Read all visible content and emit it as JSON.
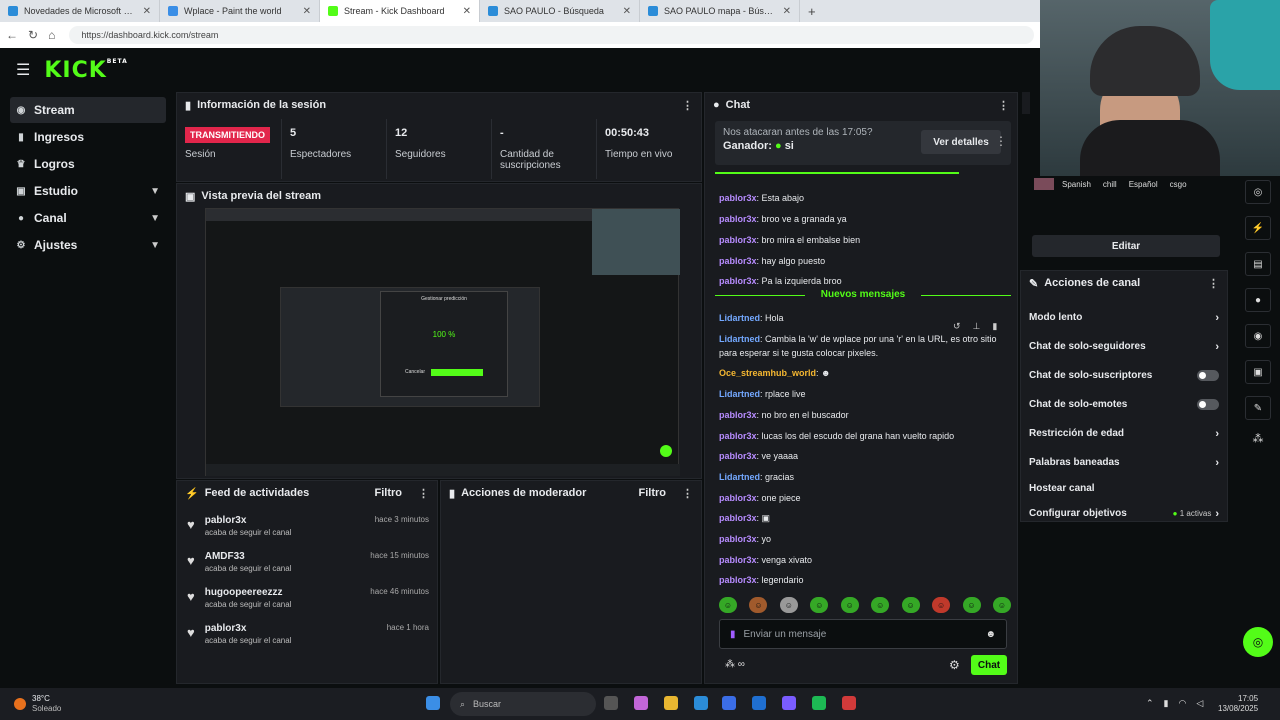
{
  "browser": {
    "tabs": [
      {
        "label": "Novedades de Microsoft Edge",
        "color": "#2b8cd8"
      },
      {
        "label": "Wplace - Paint the world",
        "color": "#3a8ee6"
      },
      {
        "label": "Stream - Kick Dashboard",
        "color": "#53fc18"
      },
      {
        "label": "SAO PAULO - Búsqueda",
        "color": "#2b8cd8"
      },
      {
        "label": "SAO PAULO mapa - Búsqueda Im",
        "color": "#2b8cd8"
      }
    ],
    "url": "https://dashboard.kick.com/stream"
  },
  "logo": "KICK",
  "logo_beta": "BETA",
  "sidebar": {
    "items": [
      {
        "label": "Stream",
        "icon": "stream-icon",
        "active": true
      },
      {
        "label": "Ingresos",
        "icon": "revenue-icon"
      },
      {
        "label": "Logros",
        "icon": "trophy-icon"
      },
      {
        "label": "Estudio",
        "icon": "studio-icon",
        "chev": true
      },
      {
        "label": "Canal",
        "icon": "user-icon",
        "chev": true
      },
      {
        "label": "Ajustes",
        "icon": "gear-icon",
        "chev": true
      }
    ]
  },
  "session": {
    "title": "Información de la sesión",
    "live": "TRANSMITIENDO",
    "live_label": "Sesión",
    "stats": [
      {
        "value": "5",
        "label": "Espectadores"
      },
      {
        "value": "12",
        "label": "Seguidores"
      },
      {
        "value": "-",
        "label": "Cantidad de suscripciones"
      },
      {
        "value": "00:50:43",
        "label": "Tiempo en vivo"
      }
    ]
  },
  "preview": {
    "title": "Vista previa del stream",
    "inner_title": "Gestionar predicción",
    "inner_pct": "100 %",
    "inner_cancel": "Cancelar"
  },
  "feed": {
    "title": "Feed de actividades",
    "filter": "Filtro",
    "items": [
      {
        "name": "pablor3x",
        "sub": "acaba de seguir el canal",
        "time": "hace 3 minutos"
      },
      {
        "name": "AMDF33",
        "sub": "acaba de seguir el canal",
        "time": "hace 15 minutos"
      },
      {
        "name": "hugoopeereezzz",
        "sub": "acaba de seguir el canal",
        "time": "hace 46 minutos"
      },
      {
        "name": "pablor3x",
        "sub": "acaba de seguir el canal",
        "time": "hace 1 hora"
      }
    ]
  },
  "mod": {
    "title": "Acciones de moderador",
    "filter": "Filtro"
  },
  "chat": {
    "title": "Chat",
    "prediction": {
      "question": "Nos atacaran antes de las 17:05?",
      "winner_label": "Ganador:",
      "winner": "si",
      "details": "Ver detalles"
    },
    "old": [
      {
        "user": "pablor3x",
        "text": "Esta abajo"
      },
      {
        "user": "pablor3x",
        "text": "broo ve a granada ya"
      },
      {
        "user": "pablor3x",
        "text": "bro mira el embalse bien"
      },
      {
        "user": "pablor3x",
        "text": "hay algo puesto"
      },
      {
        "user": "pablor3x",
        "text": "Pa la izquierda broo"
      }
    ],
    "new_label": "Nuevos mensajes",
    "new": [
      {
        "user": "Lidartned",
        "cls": "l",
        "text": "Hola"
      },
      {
        "user": "Lidartned",
        "cls": "l",
        "text": "Cambia la 'w' de wplace por una 'r' en la URL, es otro sitio para esperar si te gusta colocar pixeles."
      },
      {
        "user": "Oce_streamhub_world",
        "cls": "o",
        "text": "☻"
      },
      {
        "user": "Lidartned",
        "cls": "l",
        "text": "rplace live"
      },
      {
        "user": "pablor3x",
        "cls": "p",
        "text": "no bro en el buscador"
      },
      {
        "user": "pablor3x",
        "cls": "p",
        "text": "lucas los del escudo del grana han vuelto rapido"
      },
      {
        "user": "pablor3x",
        "cls": "p",
        "text": "ve yaaaa"
      },
      {
        "user": "Lidartned",
        "cls": "l",
        "text": "gracias"
      },
      {
        "user": "pablor3x",
        "cls": "p",
        "text": "one piece"
      },
      {
        "user": "pablor3x",
        "cls": "p",
        "text": "▣"
      },
      {
        "user": "pablor3x",
        "cls": "p",
        "text": "yo"
      },
      {
        "user": "pablor3x",
        "cls": "p",
        "text": "venga xivato"
      },
      {
        "user": "pablor3x",
        "cls": "p",
        "text": "legendario"
      }
    ],
    "placeholder": "Enviar un mensaje",
    "send": "Chat",
    "points": "∞"
  },
  "right": {
    "tags": [
      "Spanish",
      "chill",
      "Español",
      "csgo"
    ],
    "edit": "Editar",
    "actions_title": "Acciones de canal",
    "actions": [
      {
        "label": "Modo lento",
        "kind": "arrow"
      },
      {
        "label": "Chat de solo-seguidores",
        "kind": "arrow"
      },
      {
        "label": "Chat de solo-suscriptores",
        "kind": "toggle"
      },
      {
        "label": "Chat de solo-emotes",
        "kind": "toggle"
      },
      {
        "label": "Restricción de edad",
        "kind": "arrow"
      },
      {
        "label": "Palabras baneadas",
        "kind": "arrow"
      },
      {
        "label": "Hostear canal",
        "kind": "none"
      },
      {
        "label": "Configurar objetivos",
        "kind": "arrow",
        "badge": "1 activas"
      }
    ]
  },
  "taskbar": {
    "weather_temp": "38°C",
    "weather_desc": "Soleado",
    "search": "Buscar",
    "time": "17:05",
    "date": "13/08/2025"
  }
}
